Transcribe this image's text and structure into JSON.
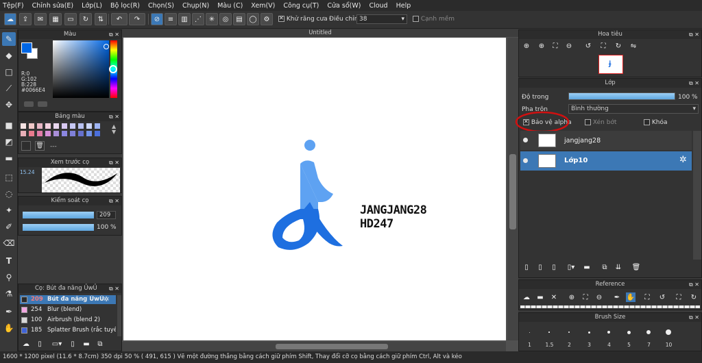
{
  "menu": [
    "Tệp(F)",
    "Chỉnh sửa(E)",
    "Lớp(L)",
    "Bộ lọc(R)",
    "Chọn(S)",
    "Chụp(N)",
    "Màu (C)",
    "Xem(V)",
    "Công cụ(T)",
    "Cửa sổ(W)",
    "Cloud",
    "Help"
  ],
  "toolbar": {
    "antialias_label": "Khử răng cưa",
    "adjust_label": "Điều chỉnh",
    "adjust_value": "38",
    "smooth_label": "Cạnh mềm"
  },
  "color_panel": {
    "title": "Màu",
    "r": "R:0",
    "g": "G:102",
    "b": "B:228",
    "hex": "#0066E4",
    "main_color": "#0066e4"
  },
  "palette_panel": {
    "title": "Bảng màu",
    "empty": "---",
    "colors": [
      "#f6e3e3",
      "#f0c8c8",
      "#e8b7c6",
      "#f3d0df",
      "#ead8f0",
      "#d8c8f2",
      "#c6c8f4",
      "#b9c2f2",
      "#cdd7f9",
      "#9fb5f5",
      "#e8b0b8",
      "#e87a8d",
      "#e07ba8",
      "#d58ed5",
      "#a98ed8",
      "#8b86e0",
      "#7f80d8",
      "#6670cc",
      "#7292e8",
      "#4b6fdc"
    ]
  },
  "brush_preview": {
    "title": "Xem trước cọ",
    "size": "15.24"
  },
  "brush_control": {
    "title": "Kiểm soát cọ",
    "size_value": "209",
    "opacity_value": "100 %"
  },
  "brush_list": {
    "title": "Cọ: Bút đa năng ỦwỦ",
    "items": [
      {
        "size": "209",
        "name": "Bút đa năng ỦwỦ",
        "color": "#2a2a2a"
      },
      {
        "size": "254",
        "name": "Blur (blend)",
        "color": "#f2a6e0"
      },
      {
        "size": "100",
        "name": "Airbrush (blend 2)",
        "color": "#d8d8d8"
      },
      {
        "size": "185",
        "name": "Splatter Brush (rắc tuyết)",
        "color": "#3f63d8"
      }
    ]
  },
  "document": {
    "tab_title": "Untitled",
    "canvas_text_1": "JANGJANG28",
    "canvas_text_2": "HD247"
  },
  "navigator": {
    "title": "Hoa tiêu"
  },
  "layer_panel": {
    "title": "Lớp",
    "opacity_label": "Độ trong",
    "opacity_value": "100 %",
    "opacity_fraction": 1.0,
    "blend_label": "Pha trộn",
    "blend_value": "Bình thường",
    "protect_alpha": "Bảo vệ alpha",
    "clip": "Xén bớt",
    "lock": "Khóa",
    "layers": [
      {
        "name": "jangjang28",
        "selected": false
      },
      {
        "name": "Lớp10",
        "selected": true
      }
    ]
  },
  "reference": {
    "title": "Reference"
  },
  "brush_size": {
    "title": "Brush Size",
    "sizes": [
      "1",
      "1.5",
      "2",
      "3",
      "4",
      "5",
      "7",
      "10"
    ]
  },
  "status": {
    "text": "1600 * 1200 pixel   (11.6 * 8.7cm)   350 dpi   50 %   ( 491, 615 )   Vẽ một đường thẳng bằng cách giữ phím Shift, Thay đổi cỡ cọ bằng cách giữ phím Ctrl, Alt và kéo"
  },
  "accent_color": "#3c78b5"
}
